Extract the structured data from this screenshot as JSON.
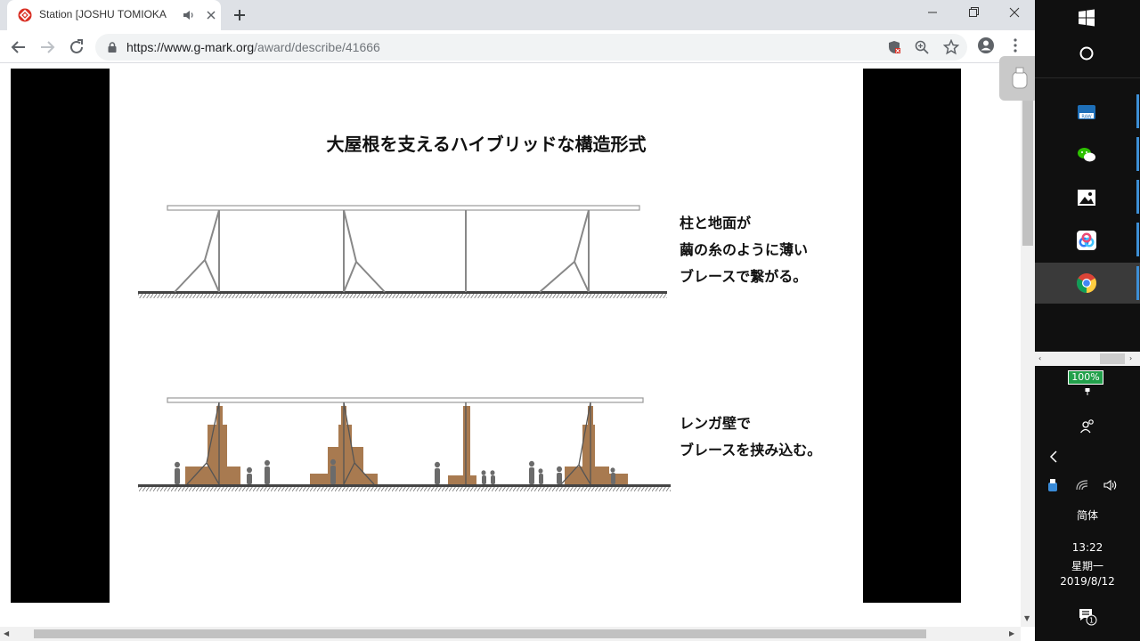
{
  "browser": {
    "tab": {
      "title": "Station [JOSHU TOMIOKA"
    },
    "address": {
      "host": "https://www.g-mark.org",
      "path": "/award/describe/41666"
    }
  },
  "slide": {
    "title": "大屋根を支えるハイブリッドな構造形式",
    "caption_top": [
      "柱と地面が",
      "繭の糸のように薄い",
      "ブレースで繋がる。"
    ],
    "caption_bottom": [
      "レンガ壁で",
      "ブレースを挟み込む。"
    ]
  },
  "taskbar": {
    "battery": "100%",
    "language": "简体",
    "time": "13:22",
    "weekday": "星期一",
    "date": "2019/8/12",
    "notification_count": "1"
  },
  "colors": {
    "brick": "#a87a50",
    "chrome_red": "#d93025",
    "taskbar_bg": "#101010",
    "battery_green": "#22a04b"
  }
}
